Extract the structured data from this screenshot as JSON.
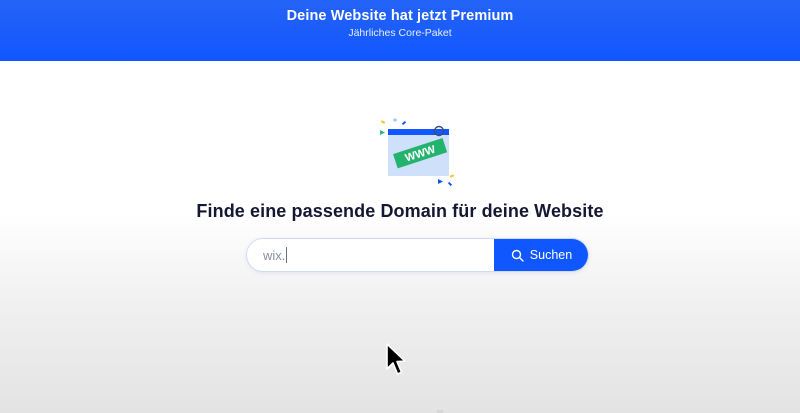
{
  "banner": {
    "title": "Deine Website hat jetzt Premium",
    "subtitle": "Jährliches Core-Paket",
    "color": "#1157ff"
  },
  "illustration": {
    "label": "WWW",
    "icon": "www-browser-illustration",
    "accent": "#1dbf73"
  },
  "main": {
    "headline": "Finde eine passende Domain für deine Website"
  },
  "search": {
    "value": "wix.",
    "button_label": "Suchen",
    "button_icon": "search-icon",
    "button_color": "#1157ff"
  },
  "pointer": {
    "icon": "mouse-cursor-icon"
  }
}
